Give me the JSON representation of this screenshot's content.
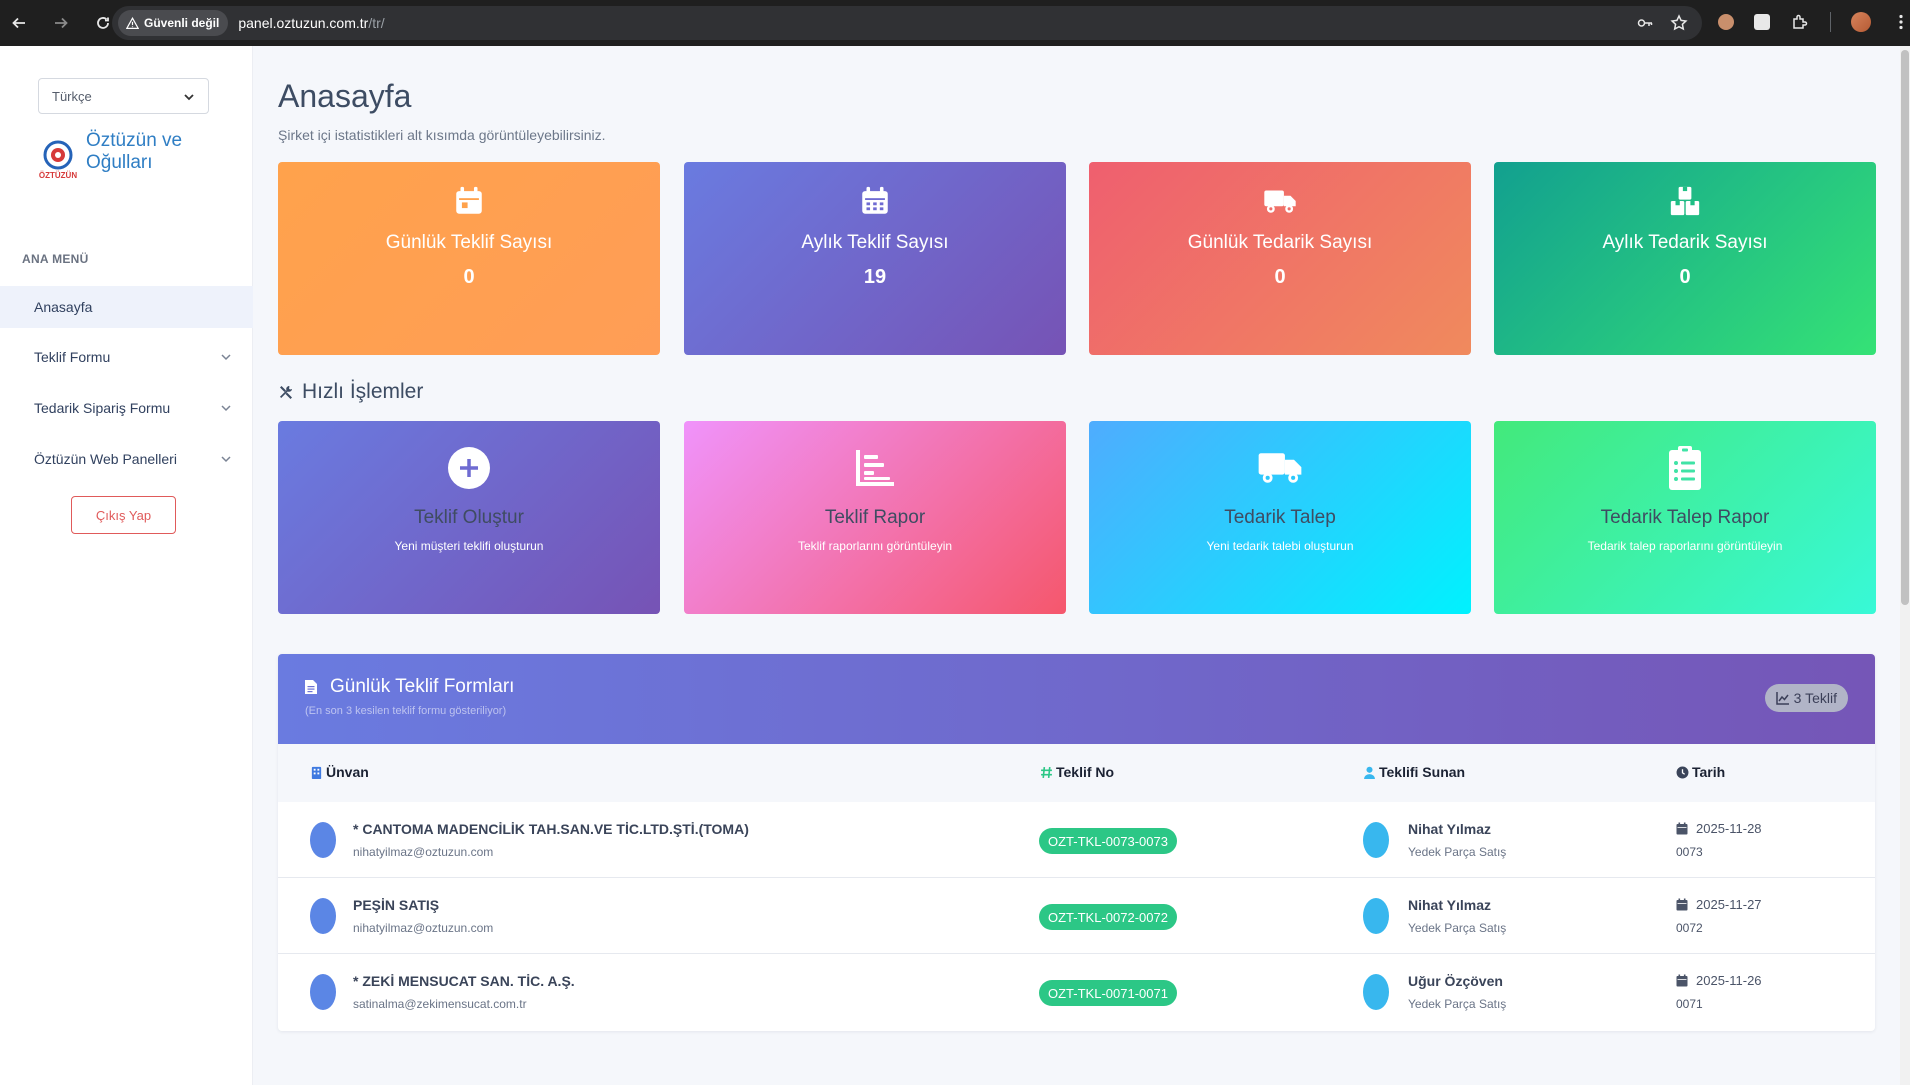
{
  "browser": {
    "security_label": "Güvenli değil",
    "url_host": "panel.oztuzun.com.tr",
    "url_path": "/tr/"
  },
  "sidebar": {
    "language": "Türkçe",
    "company_line1": "Öztüzün ve",
    "company_line2": "Oğulları",
    "logo_text": "ÖZTÜZÜN",
    "menu_heading": "ANA MENÜ",
    "items": [
      {
        "label": "Anasayfa",
        "active": true
      },
      {
        "label": "Teklif Formu",
        "expandable": true
      },
      {
        "label": "Tedarik Sipariş Formu",
        "expandable": true
      },
      {
        "label": "Öztüzün Web Panelleri",
        "expandable": true
      }
    ],
    "logout_label": "Çıkış Yap"
  },
  "page": {
    "title": "Anasayfa",
    "subtitle": "Şirket içi istatistikleri alt kısımda görüntüleyebilirsiniz."
  },
  "stats": [
    {
      "label": "Günlük Teklif Sayısı",
      "value": "0",
      "icon": "calendar-icon",
      "colors": [
        "#ffa24c",
        "#ff9d56"
      ]
    },
    {
      "label": "Aylık Teklif Sayısı",
      "value": "19",
      "icon": "calendar-grid-icon",
      "colors": [
        "#6a7be0",
        "#7653b5"
      ]
    },
    {
      "label": "Günlük Tedarik Sayısı",
      "value": "0",
      "icon": "truck-icon",
      "colors": [
        "#ef5f6f",
        "#f08a5d"
      ]
    },
    {
      "label": "Aylık Tedarik Sayısı",
      "value": "0",
      "icon": "boxes-icon",
      "colors": [
        "#12a08f",
        "#35e276"
      ]
    }
  ],
  "quick_actions": {
    "heading": "Hızlı İşlemler",
    "items": [
      {
        "title": "Teklif Oluştur",
        "desc": "Yeni müşteri teklifi oluşturun",
        "icon": "plus-circle-icon",
        "colors": [
          "#6a7be0",
          "#7653b5"
        ]
      },
      {
        "title": "Teklif Rapor",
        "desc": "Teklif raporlarını görüntüleyin",
        "icon": "chart-icon",
        "colors": [
          "#f093fb",
          "#f5576c"
        ]
      },
      {
        "title": "Tedarik Talep",
        "desc": "Yeni tedarik talebi oluşturun",
        "icon": "truck-icon",
        "colors": [
          "#4facfe",
          "#00f2fe"
        ]
      },
      {
        "title": "Tedarik Talep Rapor",
        "desc": "Tedarik talep raporlarını görüntüleyin",
        "icon": "clipboard-icon",
        "colors": [
          "#43e97b",
          "#38f9d7"
        ]
      }
    ]
  },
  "table": {
    "title": "Günlük Teklif Formları",
    "subtitle": "(En son 3 kesilen teklif formu gösteriliyor)",
    "count_badge": "3 Teklif",
    "columns": [
      "Ünvan",
      "Teklif No",
      "Teklifi Sunan",
      "Tarih"
    ],
    "rows": [
      {
        "company": "* CANTOMA MADENCİLİK TAH.SAN.VE TİC.LTD.ŞTİ.(TOMA)",
        "email": "nihatyilmaz@oztuzun.com",
        "code": "OZT-TKL-0073-0073",
        "user": "Nihat Yılmaz",
        "dept": "Yedek Parça Satış",
        "date": "2025-11-28",
        "date_sub": "0073"
      },
      {
        "company": "PEŞİN SATIŞ",
        "email": "nihatyilmaz@oztuzun.com",
        "code": "OZT-TKL-0072-0072",
        "user": "Nihat Yılmaz",
        "dept": "Yedek Parça Satış",
        "date": "2025-11-27",
        "date_sub": "0072"
      },
      {
        "company": "* ZEKİ MENSUCAT SAN. TİC. A.Ş.",
        "email": "satinalma@zekimensucat.com.tr",
        "code": "OZT-TKL-0071-0071",
        "user": "Uğur Özçöven",
        "dept": "Yedek Parça Satış",
        "date": "2025-11-26",
        "date_sub": "0071"
      }
    ]
  }
}
